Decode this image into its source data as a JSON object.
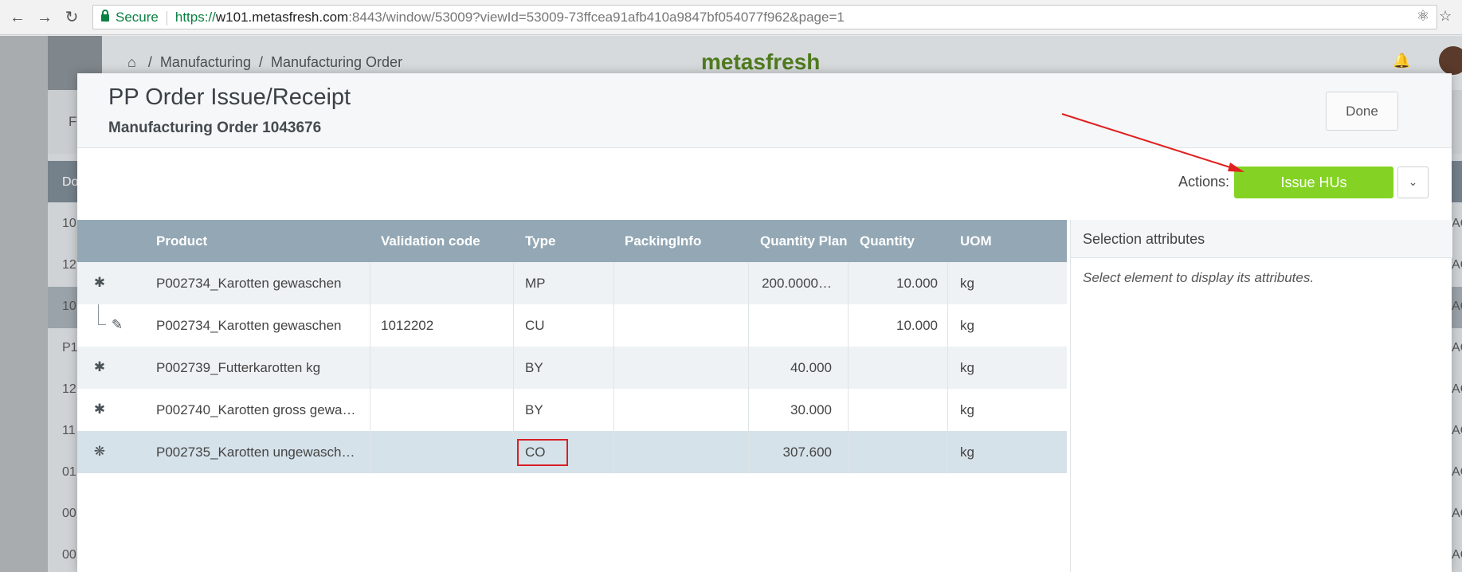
{
  "browser": {
    "secure_label": "Secure",
    "url_scheme": "https://",
    "url_host": "w101.metasfresh.com",
    "url_rest": ":8443/window/53009?viewId=53009-73ffcea91afb410a9847bf054077f962&page=1",
    "back_icon": "arrow-left-icon",
    "forward_icon": "arrow-right-icon",
    "reload_icon": "reload-icon"
  },
  "background": {
    "breadcrumb": [
      "Manufacturing",
      "Manufacturing Order"
    ],
    "logo": "metasfresh",
    "filter_label": "F",
    "rows": [
      {
        "left": "10",
        "right": "AC"
      },
      {
        "left": "12",
        "right": "AC"
      },
      {
        "left": "10",
        "right": "AC"
      },
      {
        "left": "P1",
        "right": "AC"
      },
      {
        "left": "12",
        "right": "AC"
      },
      {
        "left": "11",
        "right": "AC"
      },
      {
        "left": "01",
        "right": "AC"
      },
      {
        "left": "00",
        "right": "AC"
      },
      {
        "left": "00",
        "right": "AC"
      }
    ],
    "head_left": "Do"
  },
  "modal": {
    "title": "PP Order Issue/Receipt",
    "subtitle": "Manufacturing Order 1043676",
    "done_label": "Done",
    "actions_label": "Actions:",
    "issue_button_label": "Issue HUs",
    "issue_button_color": "#84d324"
  },
  "table": {
    "columns": [
      "Product",
      "Validation code",
      "Type",
      "PackingInfo",
      "Quantity Plan",
      "Quantity",
      "UOM"
    ],
    "rows": [
      {
        "icon": "gear-icon",
        "product": "P002734_Karotten gewaschen",
        "validation": "",
        "type": "MP",
        "packing": "",
        "qty_plan": "200.0000…",
        "quantity": "10.000",
        "uom": "kg"
      },
      {
        "icon": "pencil-icon",
        "product": "P002734_Karotten gewaschen",
        "validation": "1012202",
        "type": "CU",
        "packing": "",
        "qty_plan": "",
        "quantity": "10.000",
        "uom": "kg"
      },
      {
        "icon": "gear-icon",
        "product": "P002739_Futterkarotten kg",
        "validation": "",
        "type": "BY",
        "packing": "",
        "qty_plan": "40.000",
        "quantity": "",
        "uom": "kg"
      },
      {
        "icon": "gear-icon",
        "product": "P002740_Karotten gross gewa…",
        "validation": "",
        "type": "BY",
        "packing": "",
        "qty_plan": "30.000",
        "quantity": "",
        "uom": "kg"
      },
      {
        "icon": "gears-icon",
        "product": "P002735_Karotten ungewasch…",
        "validation": "",
        "type": "CO",
        "packing": "",
        "qty_plan": "307.600",
        "quantity": "",
        "uom": "kg"
      }
    ]
  },
  "side_panel": {
    "title": "Selection attributes",
    "message": "Select element to display its attributes."
  },
  "annotation": {
    "arrow_color": "#e02020",
    "highlight_color": "#d81f26"
  }
}
